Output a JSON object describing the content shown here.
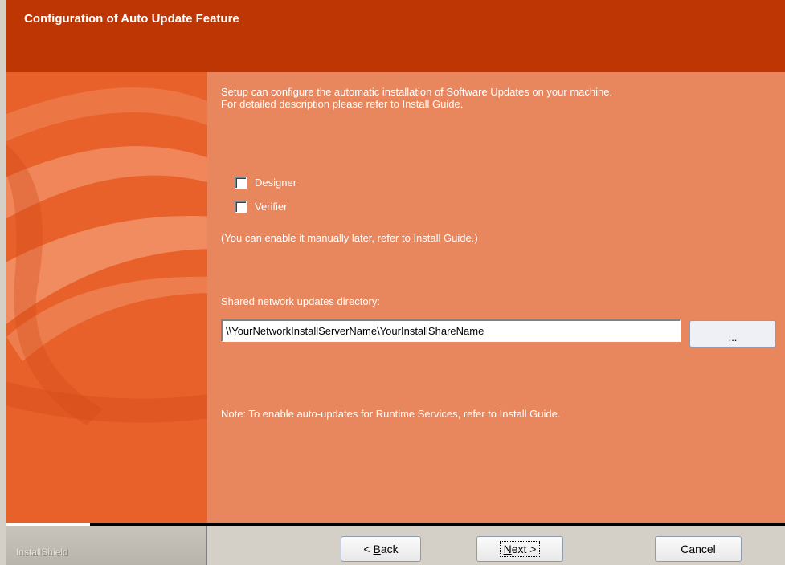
{
  "header": {
    "title": "Configuration of Auto Update Feature"
  },
  "content": {
    "intro_line1": "Setup can configure the automatic installation of Software Updates on your machine.",
    "intro_line2": "For detailed description please refer to Install Guide.",
    "checkboxes": [
      {
        "label": "Designer",
        "checked": false
      },
      {
        "label": "Verifier",
        "checked": false
      }
    ],
    "manual_note": "(You can enable it manually later, refer to Install Guide.)",
    "directory_label": "Shared network updates directory:",
    "directory_value": "\\\\YourNetworkInstallServerName\\YourInstallShareName",
    "browse_label": "...",
    "runtime_note": "Note: To enable auto-updates for Runtime Services, refer to Install Guide."
  },
  "footer": {
    "brand": "InstallShield",
    "back_prefix": "< ",
    "back_accel": "B",
    "back_rest": "ack",
    "next_accel": "N",
    "next_rest": "ext >",
    "cancel_label": "Cancel"
  },
  "colors": {
    "header_bg": "#bd3604",
    "content_bg": "#e8865e",
    "side_bg": "#e8602a"
  }
}
